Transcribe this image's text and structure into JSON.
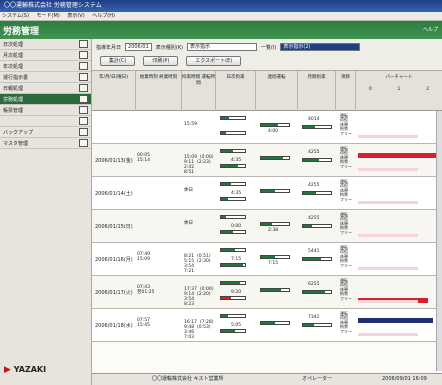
{
  "window": {
    "title": "〇〇運輸株式会社 労務管理システム"
  },
  "menu": [
    "システム(S)",
    "モード(M)",
    "表示(V)",
    "ヘルプ(H)"
  ],
  "header": {
    "title": "労務管理",
    "help": "ヘルプ"
  },
  "sidebar": {
    "items": [
      {
        "label": "日次処理",
        "active": false
      },
      {
        "label": "月次処理",
        "active": false
      },
      {
        "label": "年次処理",
        "active": false
      },
      {
        "label": "運行指示書",
        "active": false
      },
      {
        "label": "日報処理",
        "active": false
      },
      {
        "label": "労務処理",
        "active": true
      },
      {
        "label": "帳票管理",
        "active": false
      },
      {
        "label": "",
        "active": false
      },
      {
        "label": "バックアップ",
        "active": false
      },
      {
        "label": "マスタ管理",
        "active": false
      }
    ],
    "logo": "YAZAKI"
  },
  "toolbar": {
    "period_label": "指導年月日",
    "period_value": "2006/01",
    "display_label": "表示種別(K)",
    "display_value": "表示指示",
    "list_label": "一覧(I)",
    "list_value": "表示指示(2)",
    "buttons": {
      "aggregate": "集計(C)",
      "print": "印刷(P)",
      "export": "エクスポート(E)"
    }
  },
  "columns": {
    "date": "年/月/日(曜日)",
    "times": "始業時刻 終業時刻",
    "work": "拘束時間 運転時間",
    "day_total": "日次拘束",
    "cont": "連続運転",
    "month": "月間拘束",
    "item": "項目",
    "bar_chart": "バーチャート",
    "scale": [
      "0",
      "1",
      "2"
    ]
  },
  "rows": [
    {
      "date": "",
      "times": "",
      "work": "15:59",
      "n1": "",
      "n2": "4:00",
      "n3": "4014"
    },
    {
      "date": "2006/01/13(金)",
      "times": "00:05\n15:14",
      "work": "15:09  (0:00)\n9:11  (2:23)\n2:42\n8:51",
      "n1": "4:35",
      "n2": "",
      "n3": "4255"
    },
    {
      "date": "2006/01/14(土)",
      "times": "",
      "work": "休日",
      "n1": "4:35",
      "n2": "",
      "n3": "4255"
    },
    {
      "date": "2006/01/15(日)",
      "times": "",
      "work": "休日",
      "n1": "0:00",
      "n2": "2:38",
      "n3": "4255"
    },
    {
      "date": "2006/01/16(月)",
      "times": "07:49\n15:09",
      "work": "8:21  (0:51)\n5:15  (2:30)\n3:54\n7:21",
      "n1": "7:15",
      "n2": "7:15",
      "n3": "5441"
    },
    {
      "date": "2006/01/17(火)",
      "times": "07:43\n翌01:25",
      "work": "17:37  (0:00)\n9:14  (2:20)\n3:54\n8:23",
      "n1": "9:20",
      "n2": "",
      "n3": "6255"
    },
    {
      "date": "2006/01/18(水)",
      "times": "07:57\n15:45",
      "work": "16:17  (7:28)\n9:48  (0:53)\n3:46\n7:03",
      "n1": "5:05",
      "n2": "",
      "n3": "7341"
    }
  ],
  "footer": {
    "company": "〇〇運輸株式会社 キスト営業所",
    "operator": "オペレーター",
    "datetime": "2006/09/01 16:09"
  }
}
